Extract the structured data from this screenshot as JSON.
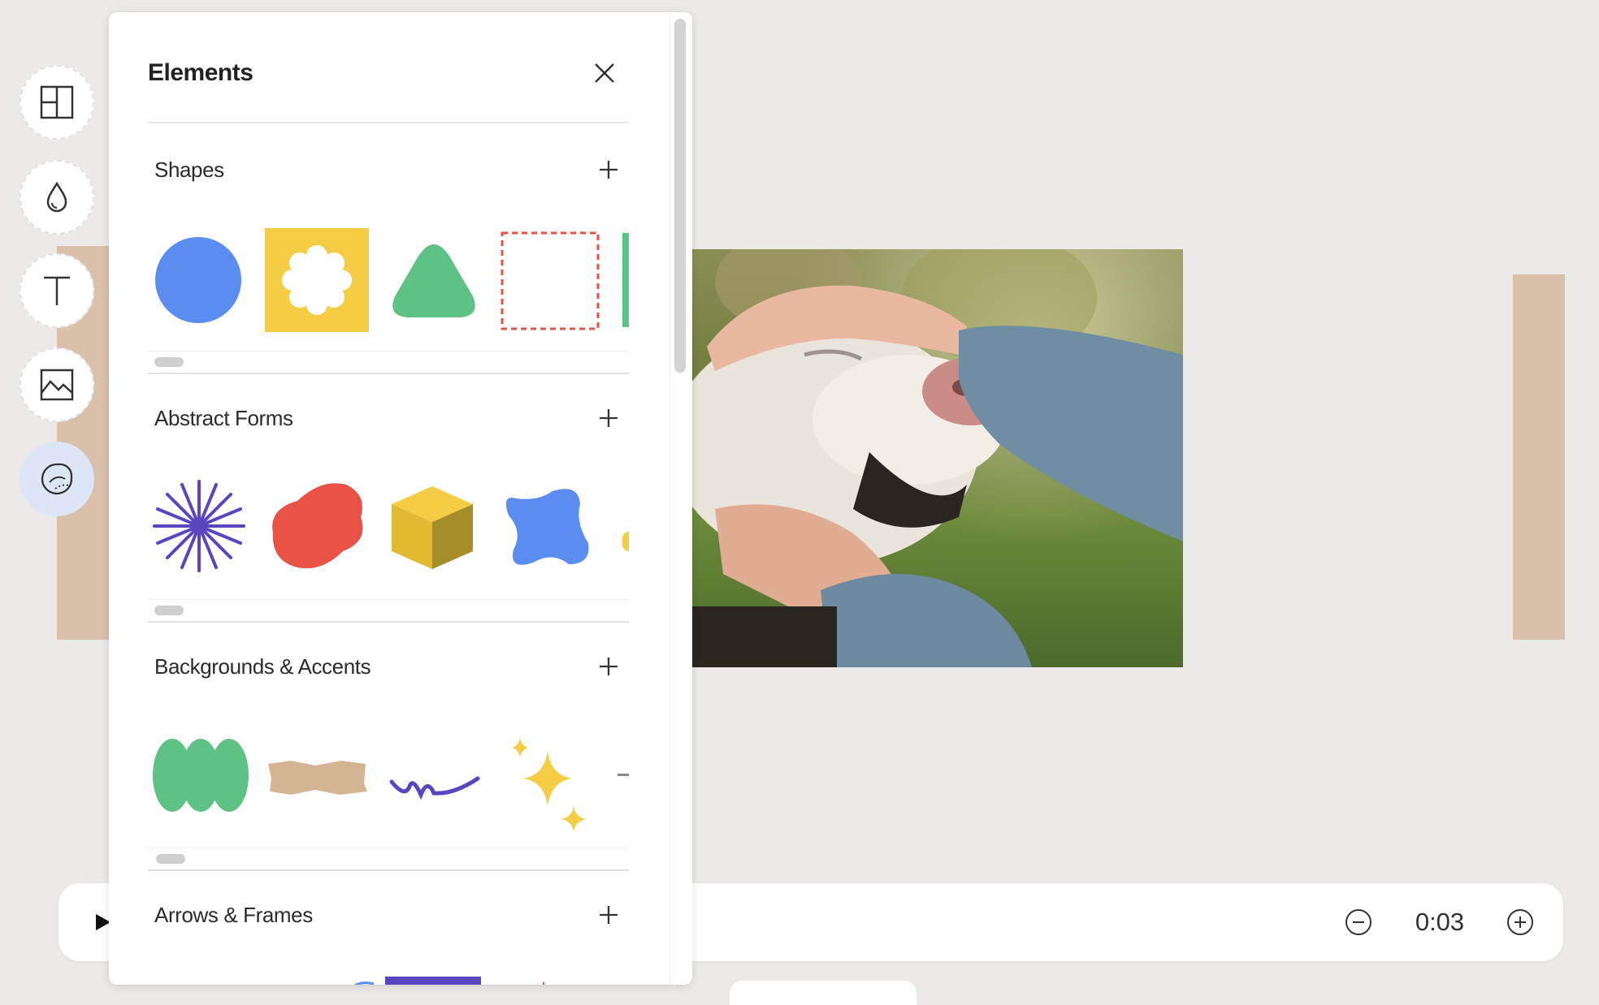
{
  "panel": {
    "title": "Elements",
    "sections": [
      {
        "title": "Shapes"
      },
      {
        "title": "Abstract Forms"
      },
      {
        "title": "Backgrounds & Accents"
      },
      {
        "title": "Arrows & Frames"
      }
    ]
  },
  "timeline": {
    "time": "0:03"
  },
  "icons": {
    "rail": [
      "layout-icon",
      "droplet-icon",
      "text-icon",
      "image-icon",
      "sticker-icon"
    ],
    "close": "close-icon",
    "add": "plus-icon",
    "play": "play-icon",
    "zoom_out": "minus-circle-icon",
    "zoom_in": "plus-circle-icon"
  },
  "colors": {
    "blue": "#5b8cf0",
    "yellow": "#f4cd45",
    "green": "#5ec285",
    "red": "#ea5245",
    "purple": "#5a45c0",
    "tan": "#d4b593",
    "accent": "#dde6f5"
  }
}
